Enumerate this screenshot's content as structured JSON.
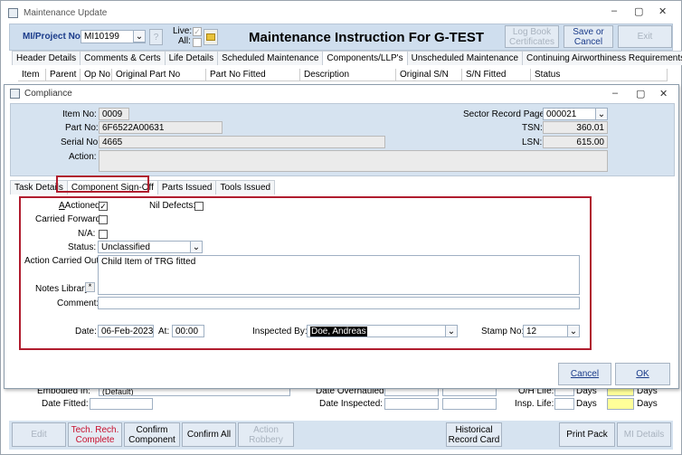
{
  "window": {
    "title": "Maintenance Update",
    "minimize": "–",
    "maximize": "▢",
    "close": "✕"
  },
  "header": {
    "project_label": "MI/Project No:",
    "project_value": "MI10199",
    "help_btn": "?",
    "live_label": "Live:",
    "all_label": "All:",
    "title": "Maintenance Instruction For G-TEST",
    "log_book_btn": "Log Book Certificates",
    "save_btn": "Save or Cancel",
    "exit_btn": "Exit"
  },
  "main_tabs": [
    "Header Details",
    "Comments & Certs",
    "Life Details",
    "Scheduled Maintenance",
    "Components/LLP's",
    "Unscheduled Maintenance",
    "Continuing Airworthiness Requirements"
  ],
  "columns": [
    "Item",
    "Parent",
    "Op No",
    "Original Part No",
    "Part No Fitted",
    "Description",
    "Original S/N",
    "S/N Fitted",
    "Status"
  ],
  "dialog": {
    "title": "Compliance",
    "item_no_label": "Item No:",
    "item_no": "0009",
    "part_no_label": "Part No:",
    "part_no": "6F6522A00631",
    "serial_no_label": "Serial No:",
    "serial_no": "4665",
    "action_label": "Action:",
    "action": "",
    "sector_label": "Sector Record Page:",
    "sector_value": "000021",
    "tsn_label": "TSN:",
    "tsn": "360.01",
    "lsn_label": "LSN:",
    "lsn": "615.00"
  },
  "sub_tabs": [
    "Task Details",
    "Component Sign-Off",
    "Parts Issued",
    "Tools Issued"
  ],
  "signoff": {
    "actioned_label": "Actioned:",
    "actioned_checked": true,
    "nil_defects_label": "Nil Defects:",
    "carried_forward_label": "Carried Forward:",
    "na_label": "N/A:",
    "status_label": "Status:",
    "status_value": "Unclassified",
    "action_out_label": "Action Carried Out:",
    "action_out_value": "Child Item of TRG fitted",
    "notes_label": "Notes Library",
    "notes_star": "*",
    "comment_label": "Comment:",
    "comment_value": "",
    "date_label": "Date:",
    "date_value": "06-Feb-2023",
    "at_label": "At:",
    "time_value": "00:00",
    "inspected_label": "Inspected By:",
    "inspected_value": "Doe, Andreas",
    "stamp_label": "Stamp No:",
    "stamp_value": "12"
  },
  "dialog_buttons": {
    "cancel": "Cancel",
    "ok": "OK"
  },
  "behind": {
    "embodied_label": "Embodied In:",
    "embodied_value": "(Default)",
    "date_fitted_label": "Date Fitted:",
    "date_overhauled_label": "Date Overhauled:",
    "date_inspected_label": "Date Inspected:",
    "oh_life_label": "O/H Life:",
    "insp_life_label": "Insp. Life:",
    "days1": "Days",
    "days2": "Days",
    "days3": "Days",
    "days4": "Days"
  },
  "footer": {
    "edit": "Edit",
    "tech_rech": "Tech. Rech. Complete",
    "confirm_component": "Confirm Component",
    "confirm_all": "Confirm All",
    "action_robbery": "Action Robbery",
    "historical": "Historical Record Card",
    "print_pack": "Print Pack",
    "mi_details": "MI Details"
  },
  "colors": {
    "red_highlight": "#b01c2e",
    "header_bg": "#cfdeee",
    "yellow": "#ffff99"
  }
}
